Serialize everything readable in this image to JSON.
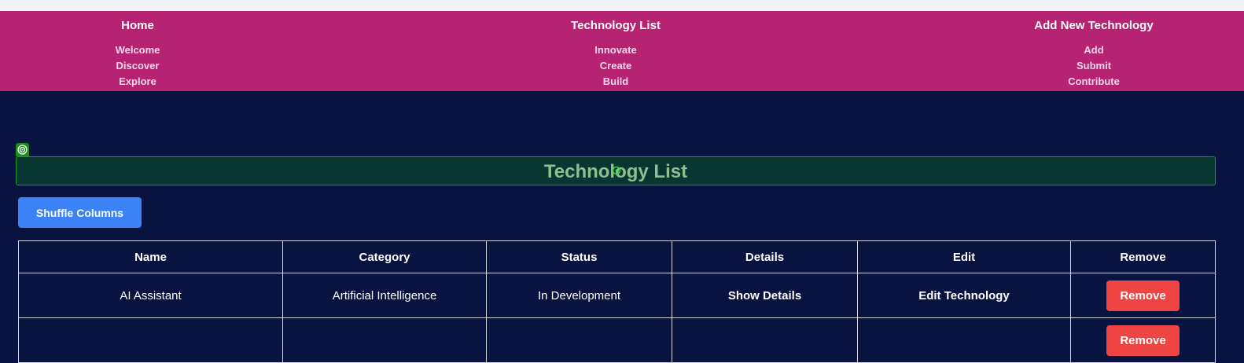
{
  "nav": {
    "home": {
      "title": "Home",
      "links": [
        "Welcome",
        "Discover",
        "Explore"
      ]
    },
    "list": {
      "title": "Technology List",
      "links": [
        "Innovate",
        "Create",
        "Build"
      ]
    },
    "add": {
      "title": "Add New Technology",
      "links": [
        "Add",
        "Submit",
        "Contribute"
      ]
    }
  },
  "page": {
    "title": "Technology List",
    "shuffle_label": "Shuffle Columns"
  },
  "table": {
    "headers": [
      "Name",
      "Category",
      "Status",
      "Details",
      "Edit",
      "Remove"
    ],
    "rows": [
      {
        "name": "AI Assistant",
        "category": "Artificial Intelligence",
        "status": "In Development",
        "details": "Show Details",
        "edit": "Edit Technology",
        "remove": "Remove"
      },
      {
        "name": "",
        "category": "",
        "status": "",
        "details": "",
        "edit": "",
        "remove": "Remove"
      }
    ]
  },
  "colors": {
    "nav_bg": "#b52372",
    "page_bg": "#081340",
    "accent_blue": "#3b82f6",
    "remove_red": "#ef4444",
    "highlight_green": "#1e9a28"
  },
  "icons": {
    "marker": "target-icon"
  }
}
